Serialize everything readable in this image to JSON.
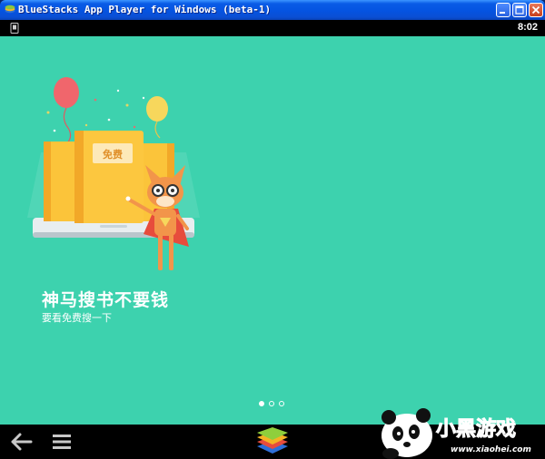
{
  "window": {
    "title": "BlueStacks App Player for Windows (beta-1)",
    "buttons": [
      "minimize",
      "maximize",
      "close"
    ]
  },
  "statusbar": {
    "time": "8:02",
    "left_icon": "phone-icon"
  },
  "slide": {
    "badge": "免费",
    "headline": "神马搜书不要钱",
    "subtitle": "要看免费搜一下",
    "page_count": 3,
    "active_page": 1
  },
  "navbar": {
    "icons": [
      "back-arrow-icon",
      "menu-icon",
      "bluestacks-logo-icon"
    ]
  },
  "watermark": {
    "brand": "小黑游戏",
    "url": "www.xiaohei.com"
  },
  "colors": {
    "background": "#3dd2ae",
    "book": "#fbc43a",
    "balloon_red": "#f0666c",
    "balloon_yellow": "#f7d75c"
  }
}
